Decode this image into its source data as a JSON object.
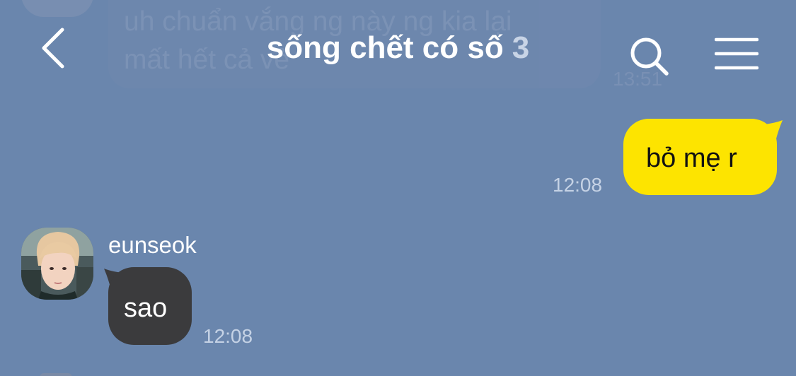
{
  "header": {
    "title": "sống chết có số",
    "member_count": "3",
    "back_icon": "chevron-left-icon",
    "search_icon": "search-icon",
    "menu_icon": "hamburger-menu-icon"
  },
  "previous_message": {
    "text": "uh chuẩn vắng ng này ng kia lại\nmất hết cả vẻ",
    "time": "13:51"
  },
  "messages": [
    {
      "sender": "me",
      "text": "bỏ mẹ r",
      "time": "12:08",
      "bubble_color": "#fde400"
    },
    {
      "sender": "eunseok",
      "text": "sao",
      "time": "12:08",
      "bubble_color": "#3b3b3d"
    }
  ],
  "colors": {
    "background": "#6a86ad",
    "my_bubble": "#fde400",
    "other_bubble": "#3b3b3d"
  }
}
